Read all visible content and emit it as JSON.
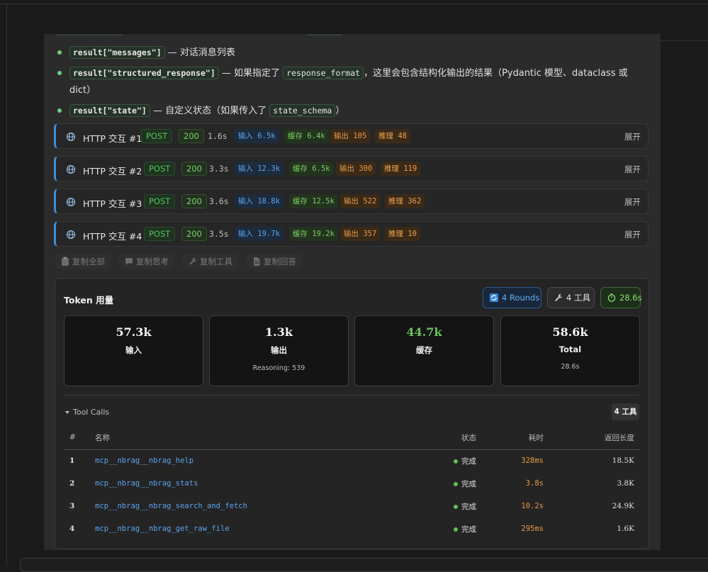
{
  "bullets": [
    {
      "code": "result[\"messages\"]",
      "text": " — 对话消息列表",
      "code2": "",
      "text2": ""
    },
    {
      "code": "result[\"structured_response\"]",
      "text": " — 如果指定了 ",
      "code2": "response_format",
      "text2": "，这里会包含结构化输出的结果（Pydantic 模型、dataclass 或 dict）"
    },
    {
      "code": "result[\"state\"]",
      "text": " — 自定义状态（如果传入了 ",
      "code2": "state_schema",
      "text2": "）"
    }
  ],
  "http": [
    {
      "title": "HTTP 交互 #1",
      "method": "POST",
      "status": "200",
      "duration": "1.6s",
      "in": "输入 6.5k",
      "cache": "缓存 6.4k",
      "out": "输出 105",
      "reason": "推理 48",
      "expand": "展开"
    },
    {
      "title": "HTTP 交互 #2",
      "method": "POST",
      "status": "200",
      "duration": "3.3s",
      "in": "输入 12.3k",
      "cache": "缓存 6.5k",
      "out": "输出 300",
      "reason": "推理 119",
      "expand": "展开"
    },
    {
      "title": "HTTP 交互 #3",
      "method": "POST",
      "status": "200",
      "duration": "3.6s",
      "in": "输入 18.8k",
      "cache": "缓存 12.5k",
      "out": "输出 522",
      "reason": "推理 362",
      "expand": "展开"
    },
    {
      "title": "HTTP 交互 #4",
      "method": "POST",
      "status": "200",
      "duration": "3.5s",
      "in": "输入 19.7k",
      "cache": "缓存 19.2k",
      "out": "输出 357",
      "reason": "推理 10",
      "expand": "展开"
    }
  ],
  "copy": {
    "all": "复制全部",
    "think": "复制思考",
    "tools": "复制工具",
    "answer": "复制回答"
  },
  "token": {
    "title": "Token 用量",
    "rounds": "4 Rounds",
    "tools": "4 工具",
    "time": "28.6s",
    "stats": [
      {
        "value": "57.3k",
        "label": "输入",
        "sub": ""
      },
      {
        "value": "1.3k",
        "label": "输出",
        "sub": "Reasoning: 539"
      },
      {
        "value": "44.7k",
        "label": "缓存",
        "sub": ""
      },
      {
        "value": "58.6k",
        "label": "Total",
        "sub": "28.6s"
      }
    ]
  },
  "tool_calls": {
    "heading": "Tool Calls",
    "badge": "4 工具",
    "columns": {
      "num": "#",
      "name": "名称",
      "status": "状态",
      "time": "耗时",
      "length": "返回长度"
    },
    "rows": [
      {
        "num": "1",
        "name": "mcp__nbrag__nbrag_help",
        "status": "完成",
        "time": "328ms",
        "length": "18.5K"
      },
      {
        "num": "2",
        "name": "mcp__nbrag__nbrag_stats",
        "status": "完成",
        "time": "3.8s",
        "length": "3.8K"
      },
      {
        "num": "3",
        "name": "mcp__nbrag__nbrag_search_and_fetch",
        "status": "完成",
        "time": "10.2s",
        "length": "24.9K"
      },
      {
        "num": "4",
        "name": "mcp__nbrag__nbrag_get_raw_file",
        "status": "完成",
        "time": "295ms",
        "length": "1.6K"
      }
    ]
  },
  "colors": {
    "accent_blue": "#3b8ede",
    "success_green": "#5cc24f",
    "warn_orange": "#e59a45"
  }
}
